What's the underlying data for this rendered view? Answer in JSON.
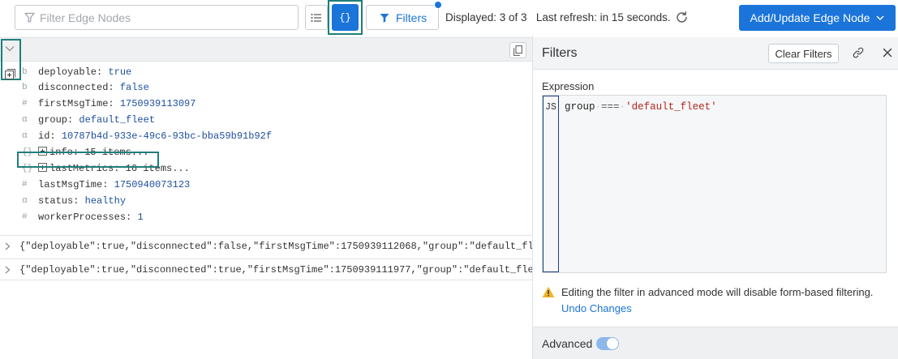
{
  "toolbar": {
    "search_placeholder": "Filter Edge Nodes",
    "list_view_icon": "list-icon",
    "json_view_label": "{}",
    "filters_label": "Filters",
    "displayed_text": "Displayed: 3 of 3",
    "last_refresh_text": "Last refresh: in 15 seconds.",
    "add_button_label": "Add/Update Edge Node",
    "accent_color": "#1b74d9"
  },
  "tree": {
    "rows": [
      {
        "type": "b",
        "key": "deployable",
        "value": "true"
      },
      {
        "type": "b",
        "key": "disconnected",
        "value": "false"
      },
      {
        "type": "#",
        "key": "firstMsgTime",
        "value": "1750939113097"
      },
      {
        "type": "α",
        "key": "group",
        "value": "default_fleet"
      },
      {
        "type": "α",
        "key": "id",
        "value": "10787b4d-933e-49c6-93bc-bba59b91b92f"
      },
      {
        "type": "{}",
        "key": "info",
        "value": "15 items..."
      },
      {
        "type": "{}",
        "key": "lastMetrics",
        "value": "16 items..."
      },
      {
        "type": "#",
        "key": "lastMsgTime",
        "value": "1750940073123"
      },
      {
        "type": "α",
        "key": "status",
        "value": "healthy"
      },
      {
        "type": "#",
        "key": "workerProcesses",
        "value": "1"
      }
    ],
    "collapsed_rows": [
      "{\"deployable\":true,\"disconnected\":false,\"firstMsgTime\":1750939112068,\"group\":\"default_fl",
      "{\"deployable\":true,\"disconnected\":true,\"firstMsgTime\":1750939111977,\"group\":\"default_fle"
    ]
  },
  "filters": {
    "title": "Filters",
    "clear_label": "Clear Filters",
    "expression_label": "Expression",
    "gutter_label": "JS",
    "code": {
      "ident": "group",
      "op": "===",
      "str": "'default_fleet'"
    },
    "warning_text": "Editing the filter in advanced mode will disable form-based filtering.",
    "undo_label": "Undo Changes",
    "advanced_label": "Advanced"
  }
}
